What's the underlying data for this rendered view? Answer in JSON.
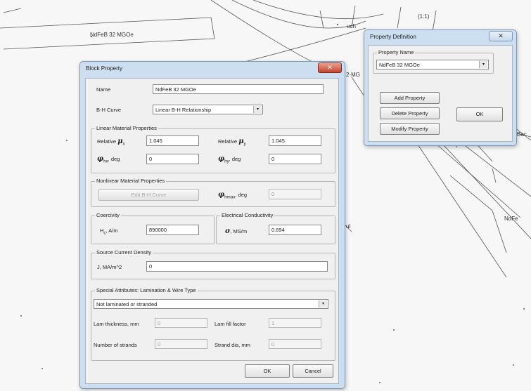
{
  "canvas": {
    "labels": {
      "ndfeb_top": "NdFeB 32 MGOe",
      "ndfeb_right": "NdFe",
      "cast_c": "uch",
      "one_to_one": "(1:1)",
      "m_left": "2-MG",
      "r_back": "Bac",
      "l_left": "ul"
    }
  },
  "block_property": {
    "title": "Block Property",
    "name_label": "Name",
    "name_value": "NdFeB 32 MGOe",
    "bh_label": "B-H Curve",
    "bh_value": "Linear B-H Relationship",
    "linear": {
      "title": "Linear Material Properties",
      "relative_label": "Relative",
      "mu_symbol": "μ",
      "mu_x_sub": "x",
      "mu_y_sub": "y",
      "mu_x_value": "1.045",
      "mu_y_value": "1.045",
      "phi_symbol": "φ",
      "phi_hx_sub": "hx",
      "phi_hy_sub": "hy",
      "deg_label": ", deg",
      "phi_hx_value": "0",
      "phi_hy_value": "0"
    },
    "nonlinear": {
      "title": "Nonlinear Material Properties",
      "edit_button": "Edit B-H Curve",
      "phi_sub": "hmax",
      "deg_label": ", deg",
      "phi_value": "0"
    },
    "coercivity": {
      "title": "Coercivity",
      "h_label": "H",
      "h_sub": "c",
      "units": ", A/m",
      "value": "890000"
    },
    "conductivity": {
      "title": "Electrical Conductivity",
      "sigma": "σ",
      "units": ", MS/m",
      "value": "0.694"
    },
    "current": {
      "title": "Source Current Density",
      "label": "J, MA/m^2",
      "value": "0"
    },
    "special": {
      "title": "Special Attributes: Lamination & Wire Type",
      "select_value": "Not laminated or stranded",
      "lam_thickness_label": "Lam thickness, mm",
      "lam_thickness_value": "0",
      "lam_fill_label": "Lam fill factor",
      "lam_fill_value": "1",
      "strands_label": "Number of strands",
      "strands_value": "0",
      "strand_dia_label": "Strand dia, mm",
      "strand_dia_value": "0"
    },
    "ok_button": "OK",
    "cancel_button": "Cancel",
    "close_glyph": "✕"
  },
  "property_definition": {
    "title": "Property Definition",
    "group_title": "Property Name",
    "selected": "NdFeB 32 MGOe",
    "add_button": "Add Property",
    "delete_button": "Delete Property",
    "modify_button": "Modify Property",
    "ok_button": "OK",
    "close_glyph": "✕"
  },
  "icons": {
    "dropdown": "▾"
  }
}
